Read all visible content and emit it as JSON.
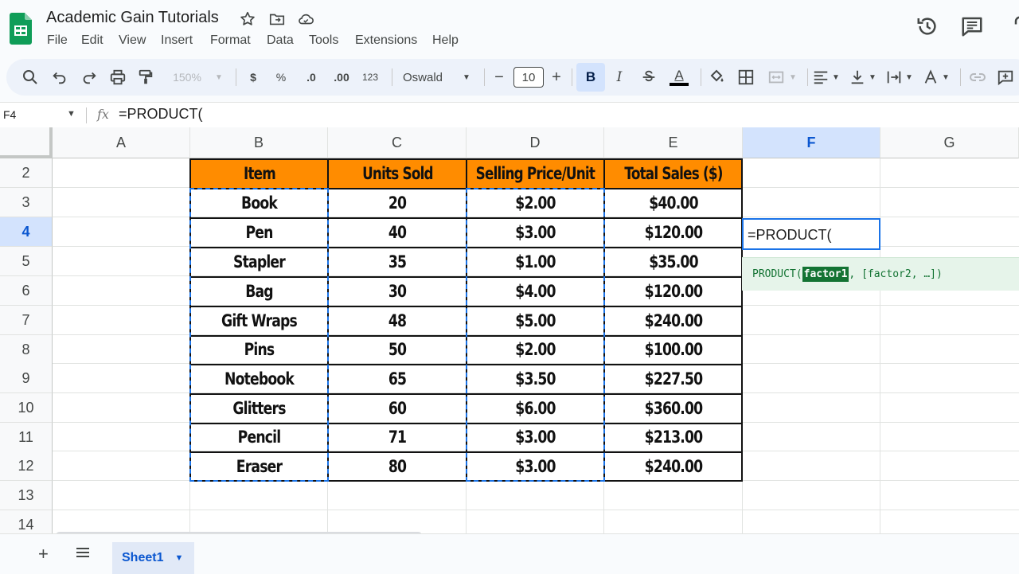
{
  "app": {
    "doc_title": "Academic Gain Tutorials",
    "menu": [
      "File",
      "Edit",
      "View",
      "Insert",
      "Format",
      "Data",
      "Tools",
      "Extensions",
      "Help"
    ]
  },
  "toolbar": {
    "zoom": "150%",
    "currency": "$",
    "percent": "%",
    "decrease_decimal": ".0",
    "increase_decimal": ".00",
    "number_format": "123",
    "font": "Oswald",
    "font_size": "10",
    "minus": "−",
    "plus": "+",
    "bold": "B",
    "italic": "I",
    "text_color_letter": "A"
  },
  "formula_bar": {
    "name_box": "F4",
    "fx": "fx",
    "formula": "=PRODUCT("
  },
  "grid": {
    "columns": [
      "A",
      "B",
      "C",
      "D",
      "E",
      "F",
      "G"
    ],
    "active_column": "F",
    "rows": [
      "2",
      "3",
      "4",
      "5",
      "6",
      "7",
      "8",
      "9",
      "10",
      "11",
      "12",
      "13",
      "14"
    ],
    "active_row": "4",
    "table_headers": [
      "Item",
      "Units Sold",
      "Selling Price/Unit",
      "Total Sales ($)"
    ],
    "table_rows": [
      [
        "Book",
        "20",
        "$2.00",
        "$40.00"
      ],
      [
        "Pen",
        "40",
        "$3.00",
        "$120.00"
      ],
      [
        "Stapler",
        "35",
        "$1.00",
        "$35.00"
      ],
      [
        "Bag",
        "30",
        "$4.00",
        "$120.00"
      ],
      [
        "Gift Wraps",
        "48",
        "$5.00",
        "$240.00"
      ],
      [
        "Pins",
        "50",
        "$2.00",
        "$100.00"
      ],
      [
        "Notebook",
        "65",
        "$3.50",
        "$227.50"
      ],
      [
        "Glitters",
        "60",
        "$6.00",
        "$360.00"
      ],
      [
        "Pencil",
        "71",
        "$3.00",
        "$213.00"
      ],
      [
        "Eraser",
        "80",
        "$3.00",
        "$240.00"
      ]
    ],
    "active_cell_text": "=PRODUCT(",
    "hint": {
      "fn": "PRODUCT(",
      "arg": "factor1",
      "rest": ", [factor2, …])"
    }
  },
  "sheets": {
    "add": "+",
    "tab_label": "Sheet1"
  },
  "colors": {
    "header_fill": "#ff8c00",
    "accent": "#1a73e8",
    "hint_green": "#137333"
  }
}
